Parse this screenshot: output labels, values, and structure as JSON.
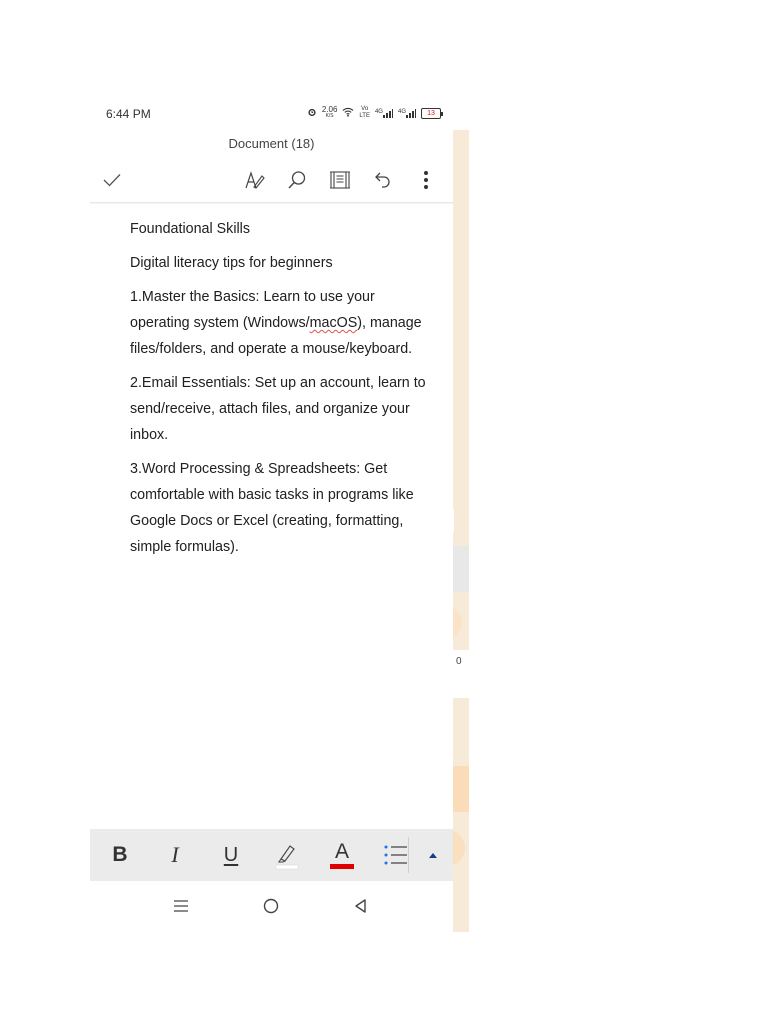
{
  "status_bar": {
    "time": "6:44 PM",
    "net_speed": "2.06",
    "net_unit": "K/S",
    "volte": "Vo",
    "lte": "LTE",
    "sig1_label": "4G",
    "sig2_label": "4G",
    "battery": "13"
  },
  "document": {
    "title": "Document (18)",
    "heading": "Foundational Skills",
    "subtitle": "Digital literacy tips for beginners",
    "p1_a": "1.Master the Basics: Learn to use your operating system (Windows/",
    "p1_misspelled": "macOS",
    "p1_b": "), manage files/folders, and operate a mouse/keyboard.",
    "p2": "2.Email Essentials: Set up an account, learn to send/receive, attach files, and organize your inbox.",
    "p3": "3.Word Processing & Spreadsheets: Get comfortable with basic tasks in programs like Google Docs or Excel (creating, formatting, simple formulas)."
  },
  "format_bar": {
    "bold": "B",
    "italic": "I",
    "underline": "U",
    "font_color": "A",
    "highlight_color": "#ffffff",
    "font_color_value": "#e00000"
  },
  "background": {
    "partial_text": "0"
  },
  "icons": {
    "toolbar": [
      "check-icon",
      "draw-pen-icon",
      "search-icon",
      "reading-view-icon",
      "undo-icon",
      "more-icon"
    ],
    "format": [
      "bold-icon",
      "italic-icon",
      "underline-icon",
      "highlighter-icon",
      "font-color-icon",
      "bullet-list-icon",
      "expand-up-icon"
    ],
    "nav": [
      "recent-apps-icon",
      "home-icon",
      "back-icon"
    ]
  },
  "colors": {
    "accent_red": "#e00000",
    "peach_bg": "#f7ead9"
  }
}
